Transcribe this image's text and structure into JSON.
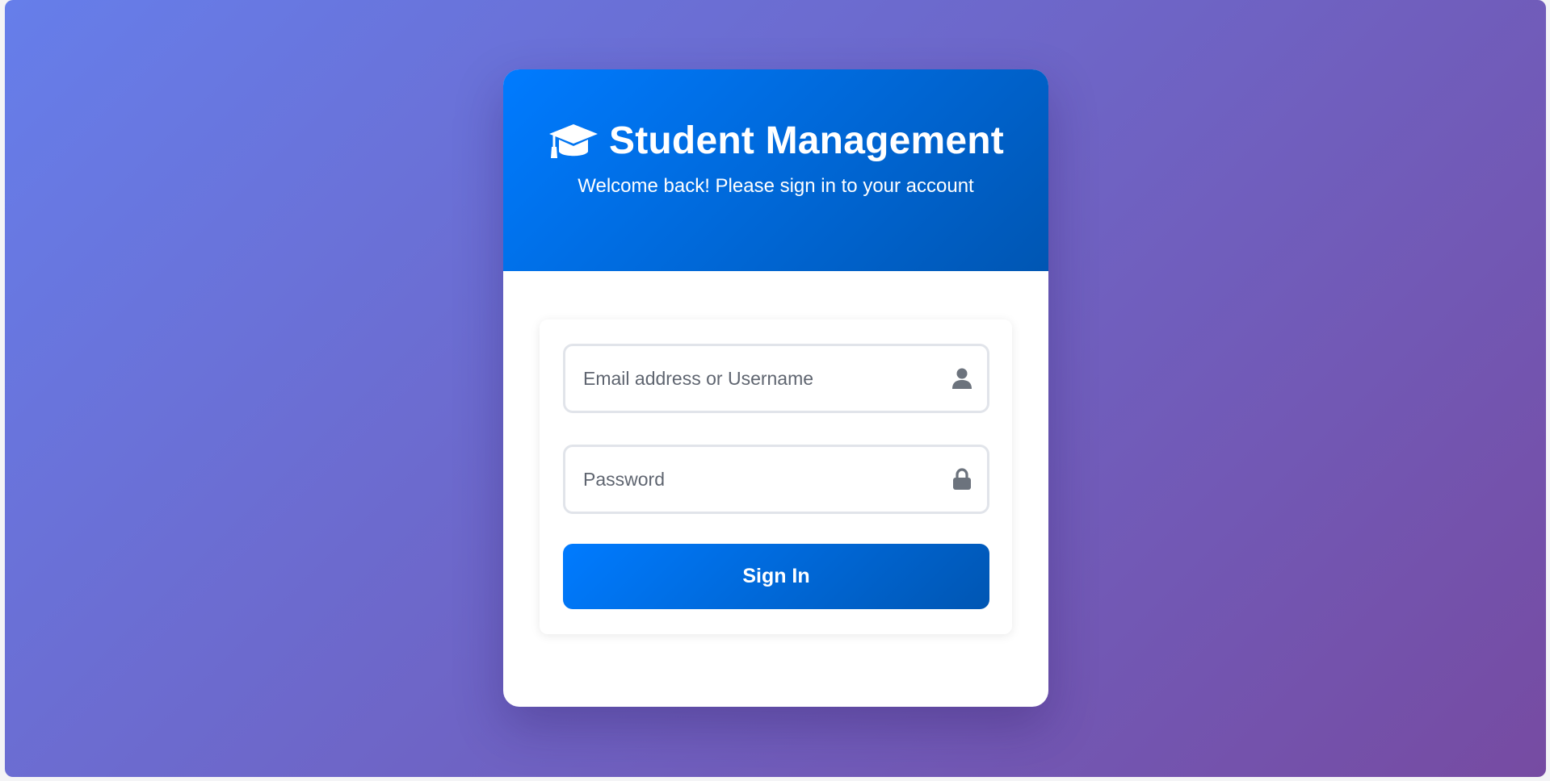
{
  "header": {
    "title": "Student Management",
    "subtitle": "Welcome back! Please sign in to your account",
    "icon": "graduation-cap-icon"
  },
  "form": {
    "username": {
      "placeholder": "Email address or Username",
      "value": "",
      "icon": "user-icon"
    },
    "password": {
      "placeholder": "Password",
      "value": "",
      "icon": "lock-icon"
    },
    "submit_label": "Sign In"
  },
  "colors": {
    "background_gradient_start": "#667eea",
    "background_gradient_end": "#764ba2",
    "primary_gradient_start": "#007bff",
    "primary_gradient_end": "#0056b3",
    "field_border": "#e1e4ea",
    "icon_gray": "#6c737d"
  }
}
